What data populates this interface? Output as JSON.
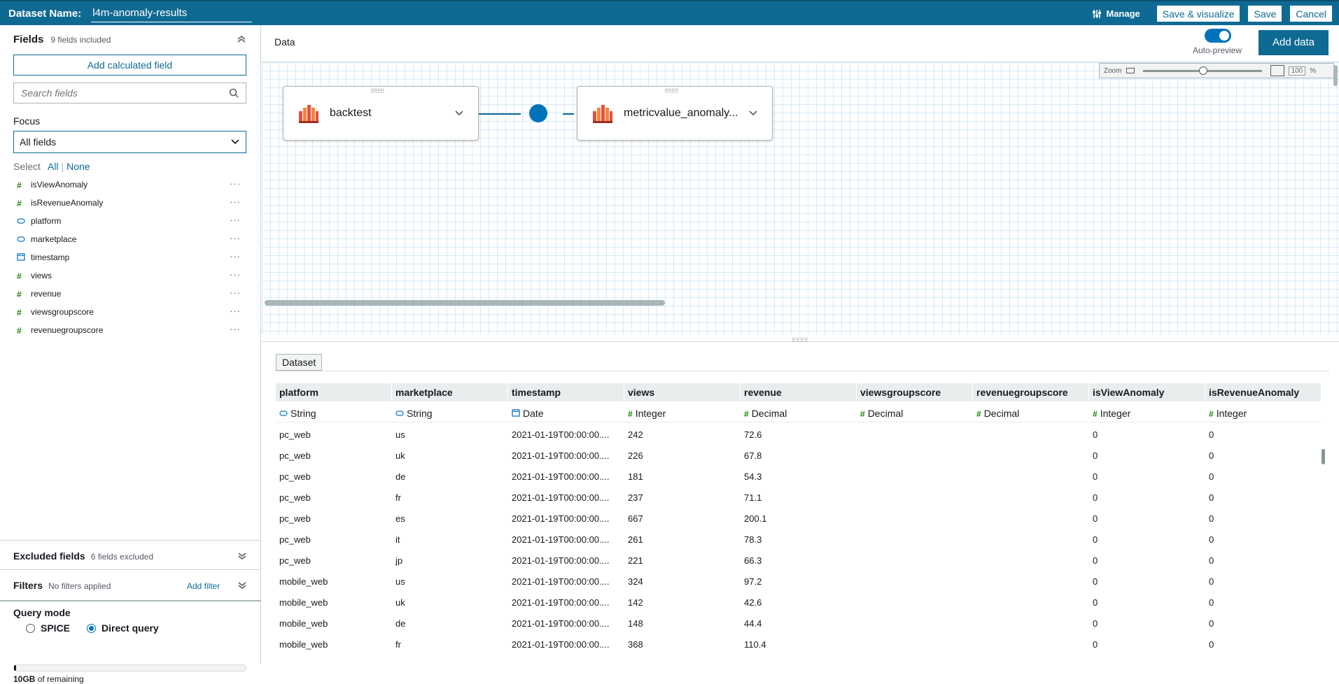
{
  "header": {
    "dataset_label": "Dataset Name:",
    "dataset_name": "l4m-anomaly-results",
    "manage": "Manage",
    "save_visualize": "Save & visualize",
    "save": "Save",
    "cancel": "Cancel"
  },
  "sidebar": {
    "fields_title": "Fields",
    "fields_included": "9 fields included",
    "add_calculated": "Add calculated field",
    "search_placeholder": "Search fields",
    "focus_label": "Focus",
    "focus_value": "All fields",
    "select_label": "Select",
    "select_all": "All",
    "select_none": "None",
    "fields": [
      {
        "name": "isViewAnomaly",
        "type": "number"
      },
      {
        "name": "isRevenueAnomaly",
        "type": "number"
      },
      {
        "name": "platform",
        "type": "string"
      },
      {
        "name": "marketplace",
        "type": "string"
      },
      {
        "name": "timestamp",
        "type": "date"
      },
      {
        "name": "views",
        "type": "number"
      },
      {
        "name": "revenue",
        "type": "number"
      },
      {
        "name": "viewsgroupscore",
        "type": "number"
      },
      {
        "name": "revenuegroupscore",
        "type": "number"
      }
    ],
    "excluded_title": "Excluded fields",
    "excluded_sub": "6 fields excluded",
    "filters_title": "Filters",
    "filters_sub": "No filters applied",
    "add_filter": "Add filter",
    "query_mode": "Query mode",
    "spice": "SPICE",
    "direct_query": "Direct query",
    "selected_mode": "Direct query",
    "spice_remaining_bold": "10GB",
    "spice_remaining_rest": " of remaining"
  },
  "main": {
    "data_title": "Data",
    "auto_preview": "Auto-preview",
    "add_data": "Add data",
    "zoom_label": "Zoom",
    "zoom_value": "100",
    "zoom_unit": "%",
    "node1": "backtest",
    "node2": "metricvalue_anomaly...",
    "dataset_tab": "Dataset"
  },
  "table": {
    "columns": [
      {
        "name": "platform",
        "type": "String",
        "kind": "string"
      },
      {
        "name": "marketplace",
        "type": "String",
        "kind": "string"
      },
      {
        "name": "timestamp",
        "type": "Date",
        "kind": "date"
      },
      {
        "name": "views",
        "type": "Integer",
        "kind": "number"
      },
      {
        "name": "revenue",
        "type": "Decimal",
        "kind": "number"
      },
      {
        "name": "viewsgroupscore",
        "type": "Decimal",
        "kind": "number"
      },
      {
        "name": "revenuegroupscore",
        "type": "Decimal",
        "kind": "number"
      },
      {
        "name": "isViewAnomaly",
        "type": "Integer",
        "kind": "number"
      },
      {
        "name": "isRevenueAnomaly",
        "type": "Integer",
        "kind": "number"
      }
    ],
    "rows": [
      [
        "pc_web",
        "us",
        "2021-01-19T00:00:00....",
        "242",
        "72.6",
        "",
        "",
        "0",
        "0"
      ],
      [
        "pc_web",
        "uk",
        "2021-01-19T00:00:00....",
        "226",
        "67.8",
        "",
        "",
        "0",
        "0"
      ],
      [
        "pc_web",
        "de",
        "2021-01-19T00:00:00....",
        "181",
        "54.3",
        "",
        "",
        "0",
        "0"
      ],
      [
        "pc_web",
        "fr",
        "2021-01-19T00:00:00....",
        "237",
        "71.1",
        "",
        "",
        "0",
        "0"
      ],
      [
        "pc_web",
        "es",
        "2021-01-19T00:00:00....",
        "667",
        "200.1",
        "",
        "",
        "0",
        "0"
      ],
      [
        "pc_web",
        "it",
        "2021-01-19T00:00:00....",
        "261",
        "78.3",
        "",
        "",
        "0",
        "0"
      ],
      [
        "pc_web",
        "jp",
        "2021-01-19T00:00:00....",
        "221",
        "66.3",
        "",
        "",
        "0",
        "0"
      ],
      [
        "mobile_web",
        "us",
        "2021-01-19T00:00:00....",
        "324",
        "97.2",
        "",
        "",
        "0",
        "0"
      ],
      [
        "mobile_web",
        "uk",
        "2021-01-19T00:00:00....",
        "142",
        "42.6",
        "",
        "",
        "0",
        "0"
      ],
      [
        "mobile_web",
        "de",
        "2021-01-19T00:00:00....",
        "148",
        "44.4",
        "",
        "",
        "0",
        "0"
      ],
      [
        "mobile_web",
        "fr",
        "2021-01-19T00:00:00....",
        "368",
        "110.4",
        "",
        "",
        "0",
        "0"
      ]
    ]
  },
  "icons": {
    "number": "hash-icon",
    "string": "string-tag-icon",
    "date": "calendar-icon"
  },
  "colors": {
    "topbar": "#0f6a93",
    "accent": "#0073bb",
    "number_type": "#1d8102"
  }
}
